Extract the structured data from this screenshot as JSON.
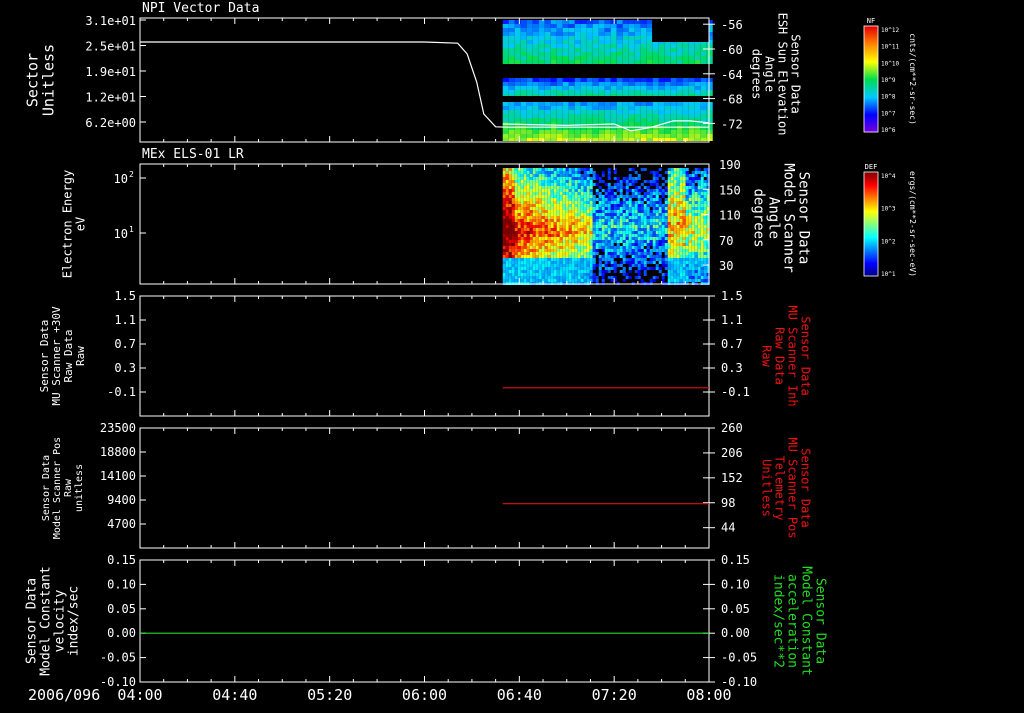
{
  "time_axis": {
    "date_label": "2006/096",
    "tick_labels": [
      "04:00",
      "04:40",
      "05:20",
      "06:00",
      "06:40",
      "07:20",
      "08:00"
    ],
    "range_minutes": [
      240,
      480
    ]
  },
  "chart_data": [
    {
      "type": "line",
      "panel_title": "NPI Vector Data",
      "ylabel_left": [
        "Sector",
        "Unitless"
      ],
      "yticks_left": [
        "3.1e+01",
        "2.5e+01",
        "1.9e+01",
        "1.2e+01",
        "6.2e+00"
      ],
      "ylim_left": [
        0,
        31
      ],
      "ylabel_right": [
        "Sensor Data",
        "ESH Sun Elevation",
        "Angle",
        "degrees"
      ],
      "yticks_right": [
        "-56",
        "-60",
        "-64",
        "-68",
        "-72"
      ],
      "ylim_right": [
        -75,
        -55
      ],
      "colorbar": {
        "label": "NF",
        "units": "cnts/(cm**2-sr-sec)",
        "tick_labels": [
          "10^12",
          "10^11",
          "10^10",
          "10^9",
          "10^8",
          "10^7",
          "10^6"
        ]
      },
      "series": [
        {
          "axis": "left",
          "color": "#ffffff",
          "x": [
            240,
            300,
            360,
            374,
            378,
            382,
            385,
            390,
            395,
            480
          ],
          "y": [
            25.0,
            25.0,
            25.0,
            24.7,
            22.0,
            15.0,
            7.0,
            3.8,
            3.7,
            3.7
          ]
        },
        {
          "axis": "right",
          "color": "#ffffff",
          "x": [
            393,
            405,
            420,
            440,
            447,
            455,
            465,
            472,
            480
          ],
          "y": [
            -72.1,
            -72.2,
            -72.3,
            -72.1,
            -73.2,
            -72.7,
            -71.6,
            -71.6,
            -71.9
          ]
        }
      ]
    },
    {
      "type": "heatmap",
      "panel_title": "MEx ELS-01 LR",
      "ylabel_left": [
        "Electron Energy",
        "eV"
      ],
      "yticks_left": [
        "10^2",
        "10^1"
      ],
      "ylabel_right": [
        "Sensor Data",
        "Model Scanner",
        "Angle",
        "degrees"
      ],
      "yticks_right": [
        "190",
        "150",
        "110",
        "70",
        "30"
      ],
      "ylim_right": [
        0,
        190
      ],
      "colorbar": {
        "label": "DEF",
        "units": "ergs/(cm**2-sr-sec-eV)",
        "tick_labels": [
          "10^4",
          "10^3",
          "10^2",
          "10^1"
        ]
      },
      "data_start_minute": 393
    },
    {
      "type": "line",
      "ylabel_left": [
        "Sensor Data",
        "MU Scanner +30V",
        "Raw Data",
        "Raw"
      ],
      "yticks_left": [
        "1.5",
        "1.1",
        "0.7",
        "0.3",
        "-0.1"
      ],
      "ylim_left": [
        -0.5,
        1.5
      ],
      "ylabel_right": [
        "Sensor Data",
        "MU Scanner Inh",
        "Raw Data",
        "Raw"
      ],
      "yticks_right": [
        "1.5",
        "1.1",
        "0.7",
        "0.3",
        "-0.1"
      ],
      "ylim_right": [
        -0.5,
        1.5
      ],
      "series": [
        {
          "axis": "right",
          "color": "#dd1111",
          "x": [
            393,
            480
          ],
          "y": [
            -0.03,
            -0.03
          ]
        }
      ]
    },
    {
      "type": "line",
      "ylabel_left": [
        "Sensor Data",
        "Model Scanner Pos",
        "Raw",
        "unitless"
      ],
      "yticks_left": [
        "23500",
        "18800",
        "14100",
        "9400",
        "4700"
      ],
      "ylim_left": [
        0,
        23500
      ],
      "ylabel_right": [
        "Sensor Data",
        "MU Scanner Pos",
        "Telemetry",
        "Unitless"
      ],
      "yticks_right": [
        "260",
        "206",
        "152",
        "98",
        "44"
      ],
      "ylim_right": [
        0,
        260
      ],
      "series": [
        {
          "axis": "right",
          "color": "#dd1111",
          "x": [
            393,
            480
          ],
          "y": [
            96,
            96
          ]
        }
      ]
    },
    {
      "type": "line",
      "ylabel_left": [
        "Sensor Data",
        "Model Constant",
        "velocity",
        "index/sec"
      ],
      "yticks_left": [
        "0.15",
        "0.10",
        "0.05",
        "0.00",
        "-0.05",
        "-0.10"
      ],
      "ylim_left": [
        -0.1,
        0.15
      ],
      "ylabel_right": [
        "Sensor Data",
        "Model Constant",
        "acceleration",
        "index/sec**2"
      ],
      "yticks_right": [
        "0.15",
        "0.10",
        "0.05",
        "0.00",
        "-0.05",
        "-0.10"
      ],
      "ylim_right": [
        -0.1,
        0.15
      ],
      "series": [
        {
          "axis": "left",
          "color": "#22dd22",
          "x": [
            240,
            480
          ],
          "y": [
            0.0,
            0.0
          ]
        }
      ]
    }
  ],
  "colors": {
    "background": "#000000",
    "foreground": "#ffffff",
    "right_label_panel3": "#ee1111",
    "right_label_panel4": "#ee1111",
    "right_label_panel5": "#22dd22"
  }
}
